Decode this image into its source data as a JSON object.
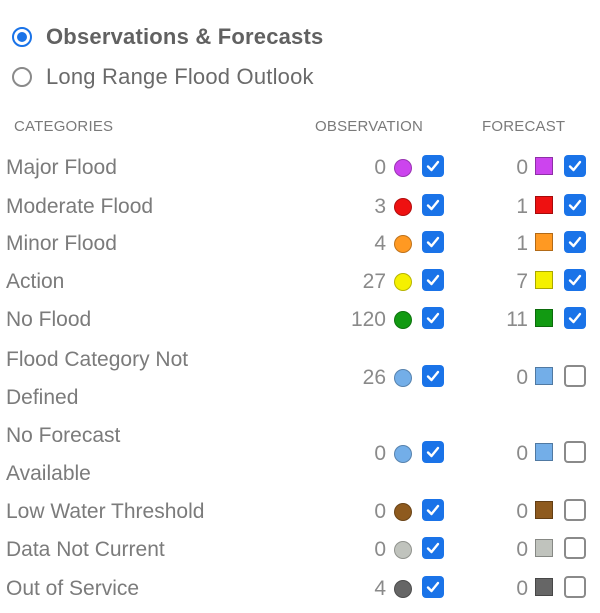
{
  "view_options": [
    {
      "label": "Observations & Forecasts",
      "selected": true
    },
    {
      "label": "Long Range Flood Outlook",
      "selected": false
    }
  ],
  "headers": {
    "categories": "CATEGORIES",
    "observation": "OBSERVATION",
    "forecast": "FORECAST"
  },
  "categories": [
    {
      "label": "Major Flood",
      "obs_count": "0",
      "obs_checked": true,
      "fc_count": "0",
      "fc_checked": true,
      "color": "#cc44ee"
    },
    {
      "label": "Moderate Flood",
      "obs_count": "3",
      "obs_checked": true,
      "fc_count": "1",
      "fc_checked": true,
      "color": "#ee1111"
    },
    {
      "label": "Minor Flood",
      "obs_count": "4",
      "obs_checked": true,
      "fc_count": "1",
      "fc_checked": true,
      "color": "#ff9922"
    },
    {
      "label": "Action",
      "obs_count": "27",
      "obs_checked": true,
      "fc_count": "7",
      "fc_checked": true,
      "color": "#f5f000"
    },
    {
      "label": "No Flood",
      "obs_count": "120",
      "obs_checked": true,
      "fc_count": "11",
      "fc_checked": true,
      "color": "#129a12"
    },
    {
      "label_line1": "Flood Category Not",
      "label_line2": "Defined",
      "obs_count": "26",
      "obs_checked": true,
      "fc_count": "0",
      "fc_checked": false,
      "color": "#73aee8"
    },
    {
      "label_line1": "No Forecast",
      "label_line2": "Available",
      "obs_count": "0",
      "obs_checked": true,
      "fc_count": "0",
      "fc_checked": false,
      "color": "#73aee8"
    },
    {
      "label": "Low Water Threshold",
      "obs_count": "0",
      "obs_checked": true,
      "fc_count": "0",
      "fc_checked": false,
      "color": "#8e5a1e"
    },
    {
      "label": "Data Not Current",
      "obs_count": "0",
      "obs_checked": true,
      "fc_count": "0",
      "fc_checked": false,
      "color": "#c0c3bd"
    },
    {
      "label": "Out of Service",
      "obs_count": "4",
      "obs_checked": true,
      "fc_count": "0",
      "fc_checked": false,
      "color": "#666666"
    }
  ],
  "accent_color": "#1a73e8"
}
